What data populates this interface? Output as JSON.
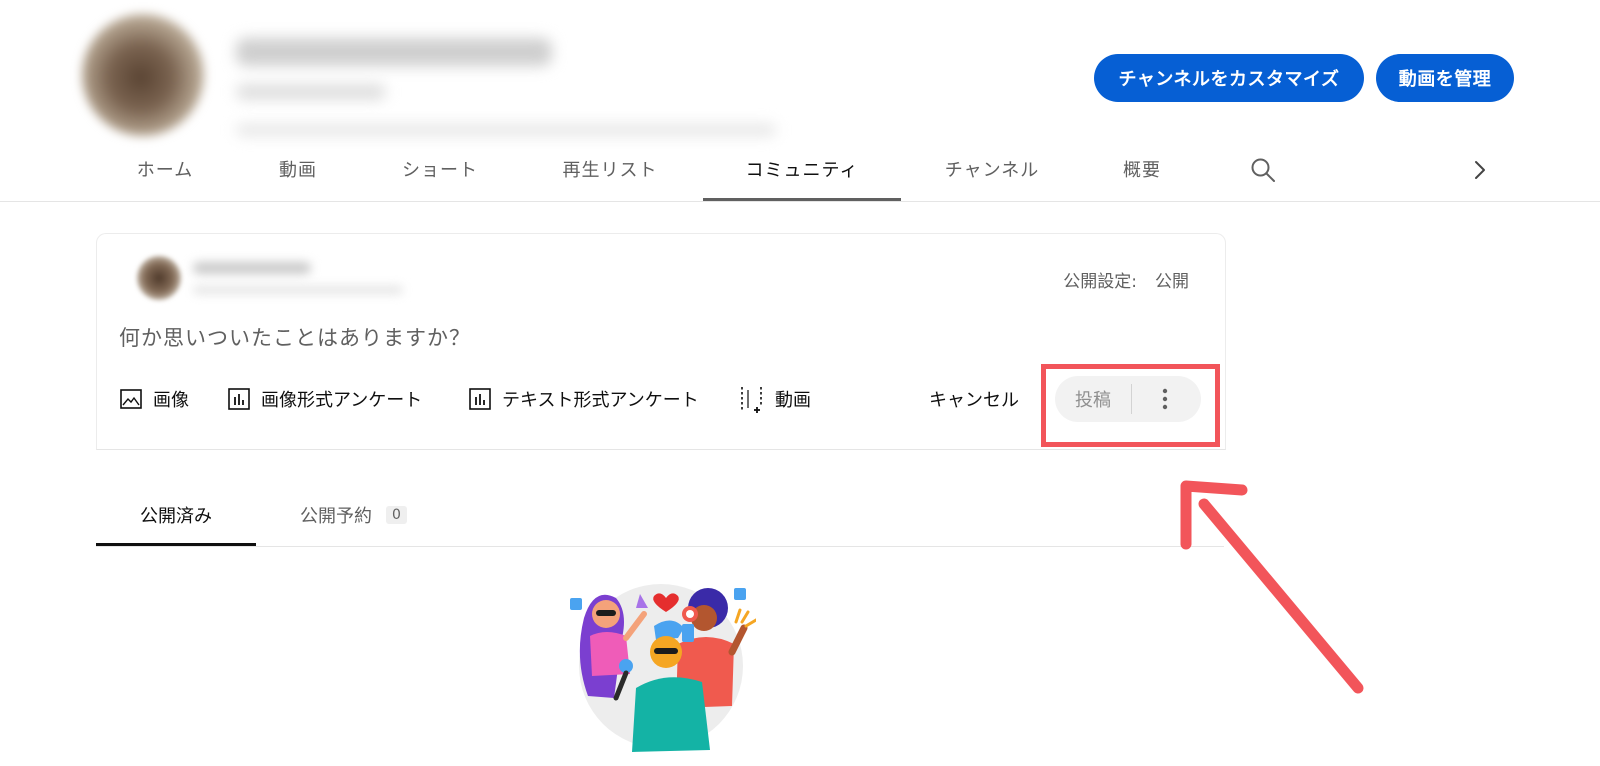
{
  "header": {
    "customize_label": "チャンネルをカスタマイズ",
    "manage_label": "動画を管理"
  },
  "tabs": [
    {
      "label": "ホーム"
    },
    {
      "label": "動画"
    },
    {
      "label": "ショート"
    },
    {
      "label": "再生リスト"
    },
    {
      "label": "コミュニティ",
      "active": true
    },
    {
      "label": "チャンネル"
    },
    {
      "label": "概要"
    }
  ],
  "composer": {
    "visibility_label": "公開設定:",
    "visibility_value": "公開",
    "placeholder": "何か思いついたことはありますか？",
    "tools": [
      {
        "label": "画像",
        "icon": "image-icon"
      },
      {
        "label": "画像形式アンケート",
        "icon": "poll-icon"
      },
      {
        "label": "テキスト形式アンケート",
        "icon": "poll-icon"
      },
      {
        "label": "動画",
        "icon": "video-add-icon"
      }
    ],
    "cancel_label": "キャンセル",
    "post_label": "投稿"
  },
  "publish_tabs": {
    "published_label": "公開済み",
    "scheduled_label": "公開予約",
    "scheduled_count": "0"
  },
  "colors": {
    "accent": "#065fd4",
    "annotation": "#f2555a"
  }
}
